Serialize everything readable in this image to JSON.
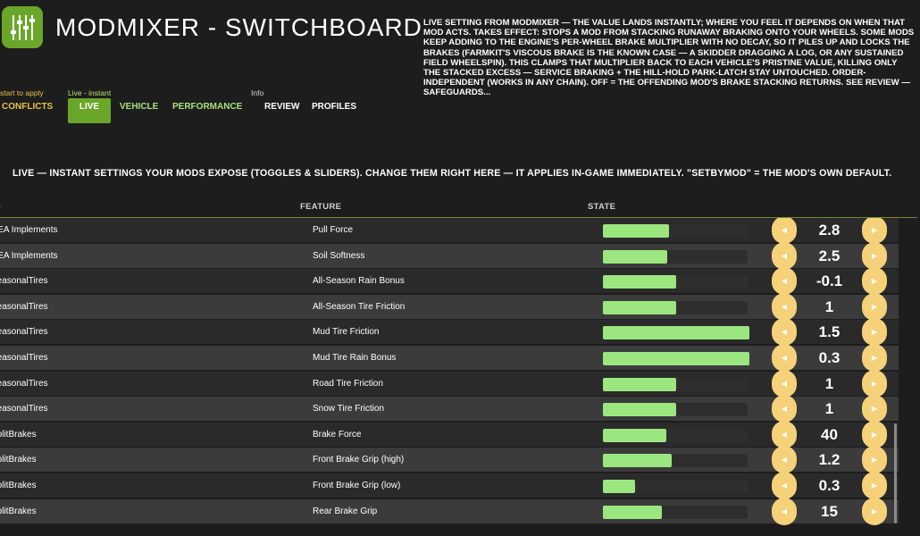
{
  "header": {
    "title": "MODMIXER - SWITCHBOARD",
    "logo_icon": "sliders-icon",
    "accent": "#6aa62a"
  },
  "description": "LIVE SETTING FROM MODMIXER — THE VALUE LANDS INSTANTLY; WHERE YOU FEEL IT DEPENDS ON WHEN THAT MOD ACTS. TAKES EFFECT: STOPS A MOD FROM STACKING RUNAWAY BRAKING ONTO YOUR WHEELS. SOME MODS KEEP ADDING TO THE ENGINE'S PER-WHEEL BRAKE MULTIPLIER WITH NO DECAY, SO IT PILES UP AND LOCKS THE BRAKES (FARMKIT'S VISCOUS BRAKE IS THE KNOWN CASE — A SKIDDER DRAGGING A LOG, OR ANY SUSTAINED FIELD WHEELSPIN). THIS CLAMPS THAT MULTIPLIER BACK TO EACH VEHICLE'S PRISTINE VALUE, KILLING ONLY THE STACKED EXCESS — SERVICE BRAKING + THE HILL-HOLD PARK-LATCH STAY UNTOUCHED. ORDER-INDEPENDENT (WORKS IN ANY CHAIN). OFF = THE OFFENDING MOD'S BRAKE STACKING RETURNS. SEE REVIEW — SAFEGUARDS...",
  "groups": {
    "restart": "start to apply",
    "live": "Live - instant",
    "info": "Info"
  },
  "tabs": {
    "conflicts": "CONFLICTS",
    "live": "LIVE",
    "vehicle": "VEHICLE",
    "performance": "PERFORMANCE",
    "review": "REVIEW",
    "profiles": "PROFILES",
    "active": "live"
  },
  "live_info": "LIVE — INSTANT SETTINGS YOUR MODS EXPOSE (TOGGLES & SLIDERS). CHANGE THEM RIGHT HERE — IT APPLIES IN-GAME IMMEDIATELY. \"SETBYMOD\" = THE MOD'S OWN DEFAULT.",
  "columns": {
    "mod": "OD",
    "feature": "FEATURE",
    "state": "STATE"
  },
  "controls": {
    "decrement_icon": "arrow-left-icon",
    "increment_icon": "arrow-right-icon"
  },
  "rows": [
    {
      "mod": "REA Implements",
      "feature": "Pull Force",
      "value": "2.8",
      "fill": 0.45
    },
    {
      "mod": "REA Implements",
      "feature": "Soil Softness",
      "value": "2.5",
      "fill": 0.44
    },
    {
      "mod": "SeasonalTires",
      "feature": "All-Season Rain Bonus",
      "value": "-0.1",
      "fill": 0.5
    },
    {
      "mod": "SeasonalTires",
      "feature": "All-Season Tire Friction",
      "value": "1",
      "fill": 0.5
    },
    {
      "mod": "SeasonalTires",
      "feature": "Mud Tire Friction",
      "value": "1.5",
      "fill": 1.0
    },
    {
      "mod": "SeasonalTires",
      "feature": "Mud Tire Rain Bonus",
      "value": "0.3",
      "fill": 1.0
    },
    {
      "mod": "SeasonalTires",
      "feature": "Road Tire Friction",
      "value": "1",
      "fill": 0.5
    },
    {
      "mod": "SeasonalTires",
      "feature": "Snow Tire Friction",
      "value": "1",
      "fill": 0.5
    },
    {
      "mod": "SplitBrakes",
      "feature": "Brake Force",
      "value": "40",
      "fill": 0.43
    },
    {
      "mod": "SplitBrakes",
      "feature": "Front Brake Grip (high)",
      "value": "1.2",
      "fill": 0.47
    },
    {
      "mod": "SplitBrakes",
      "feature": "Front Brake Grip (low)",
      "value": "0.3",
      "fill": 0.22
    },
    {
      "mod": "SplitBrakes",
      "feature": "Rear Brake Grip",
      "value": "15",
      "fill": 0.4
    }
  ]
}
